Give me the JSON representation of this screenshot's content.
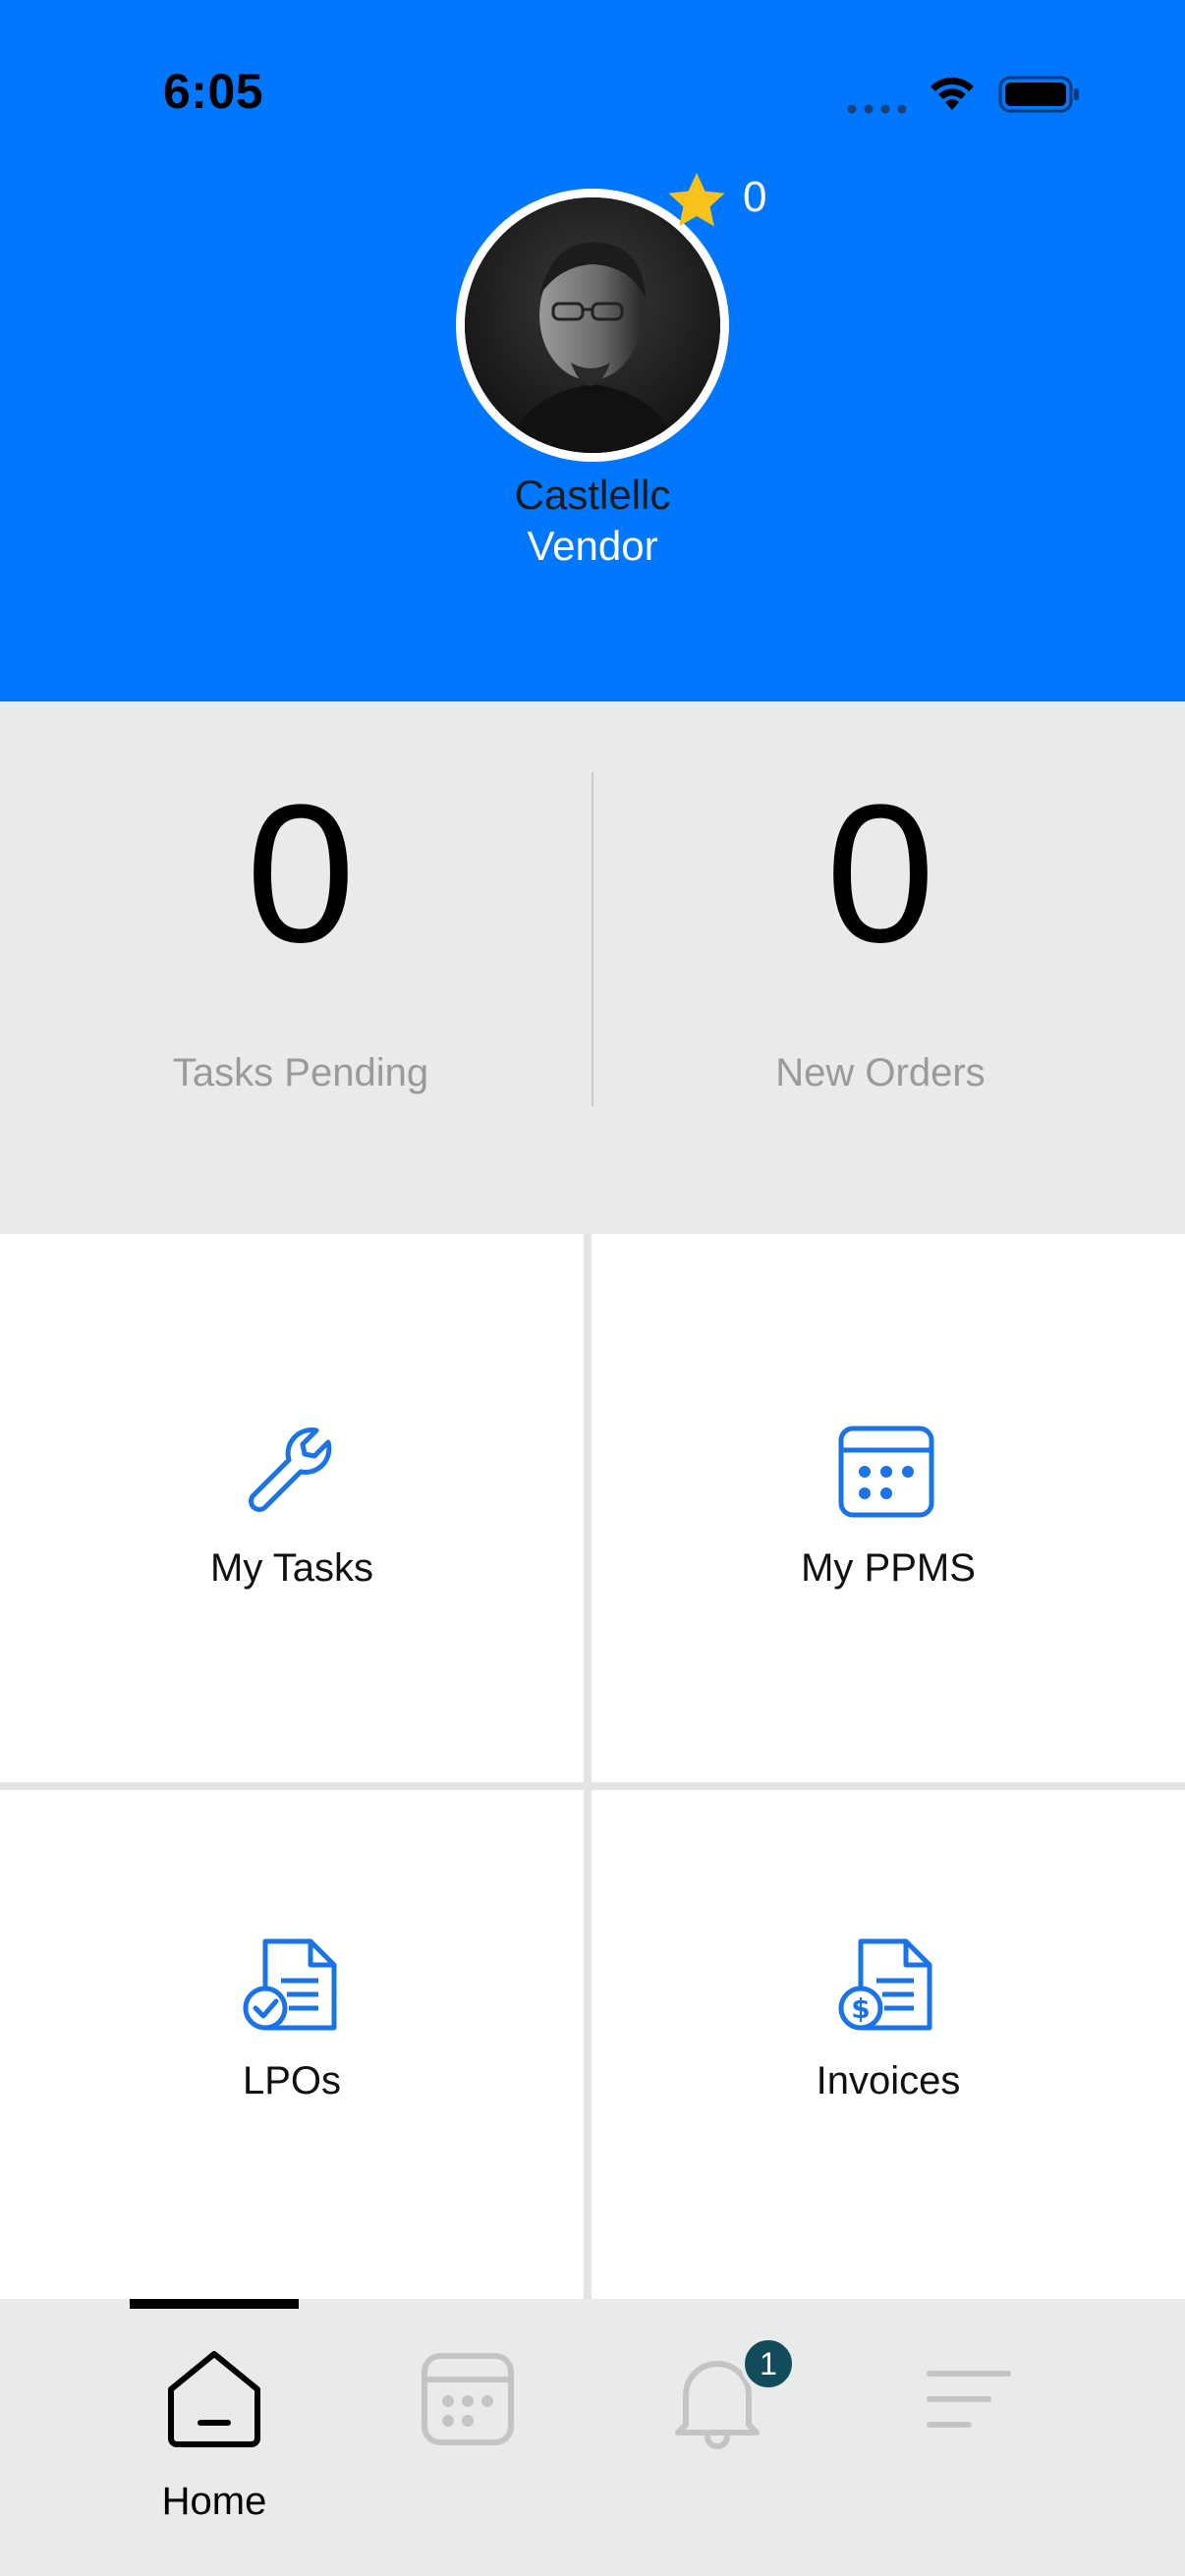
{
  "status_bar": {
    "time": "6:05"
  },
  "profile": {
    "rating": "0",
    "name": "Castlellc",
    "role": "Vendor"
  },
  "stats": {
    "tasks_pending_value": "0",
    "tasks_pending_label": "Tasks Pending",
    "new_orders_value": "0",
    "new_orders_label": "New Orders"
  },
  "tiles": {
    "my_tasks": "My Tasks",
    "my_ppms": "My PPMS",
    "lpos": "LPOs",
    "invoices": "Invoices"
  },
  "tabbar": {
    "home_label": "Home",
    "notification_badge": "1",
    "active_tab": "home"
  },
  "colors": {
    "header_blue": "#0077FC",
    "icon_blue": "#1A73E8",
    "badge_teal": "#124C5A",
    "star_yellow": "#F7C21A",
    "panel_gray": "#E9EAEA"
  },
  "icons": {
    "header": [
      "star-icon"
    ],
    "tiles": [
      "wrench-icon",
      "calendar-grid-icon",
      "document-check-icon",
      "document-dollar-icon"
    ],
    "tabbar": [
      "home-icon",
      "calendar-icon",
      "bell-icon",
      "menu-lines-icon"
    ],
    "status": [
      "signal-dots-icon",
      "wifi-icon",
      "battery-icon"
    ]
  }
}
